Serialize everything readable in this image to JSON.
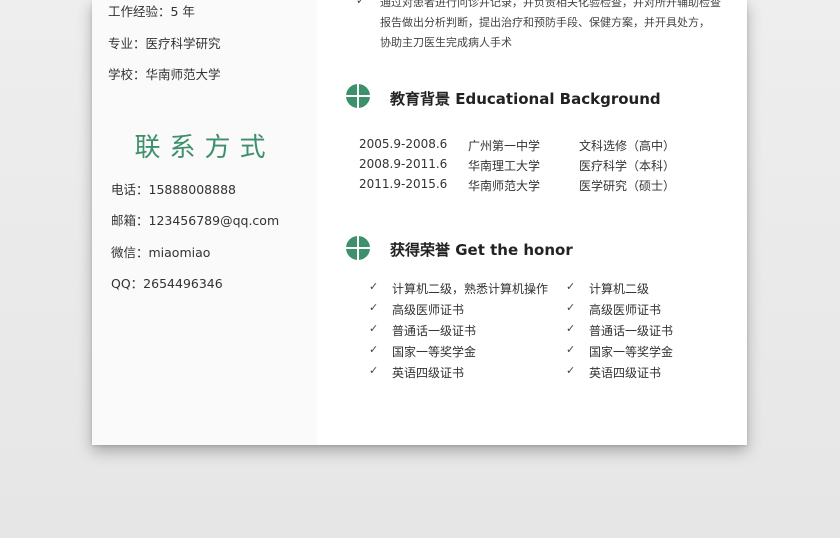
{
  "sidebar": {
    "info": [
      {
        "label": "工作经验：5 年"
      },
      {
        "label": "专业：医疗科学研究"
      },
      {
        "label": "学校：华南师范大学"
      }
    ],
    "contact_title": "联系方式",
    "contacts": [
      {
        "label": "电话：15888008888"
      },
      {
        "label": "邮箱：123456789@qq.com"
      },
      {
        "label": "微信：miaomiao"
      },
      {
        "label": "QQ：2654496346"
      }
    ]
  },
  "experience": {
    "check": "✓",
    "lines": [
      "通过对患者进行问诊并记录，并负责相关化验检查，并对所开辅助检查",
      "报告做出分析判断，提出治疗和预防手段、保健方案，并开具处方，",
      "协助主刀医生完成病人手术"
    ]
  },
  "education": {
    "title": "教育背景 Educational Background",
    "rows": [
      {
        "period": "2005.9-2008.6",
        "school": "广州第一中学",
        "major": "文科选修（高中）"
      },
      {
        "period": "2008.9-2011.6",
        "school": "华南理工大学",
        "major": "医疗科学（本科）"
      },
      {
        "period": "2011.9-2015.6",
        "school": "华南师范大学",
        "major": "医学研究（硕士）"
      }
    ]
  },
  "honors": {
    "title": "获得荣誉 Get the honor",
    "check": "✓",
    "left": [
      "计算机二级，熟悉计算机操作",
      "高级医师证书",
      "普通话一级证书",
      "国家一等奖学金",
      "英语四级证书"
    ],
    "right": [
      "计算机二级",
      "高级医师证书",
      "普通话一级证书",
      "国家一等奖学金",
      "英语四级证书"
    ]
  },
  "colors": {
    "accent": "#3e8f6c",
    "page_bg": "#ececec",
    "sheet_bg": "#ffffff"
  },
  "icons": {
    "section_icon": "crosshair-circle-icon",
    "check_icon": "check-icon"
  }
}
